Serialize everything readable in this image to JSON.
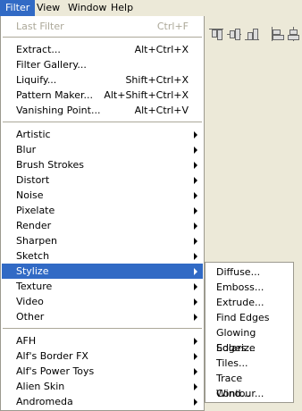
{
  "menubar": {
    "items": [
      {
        "label": "Filter",
        "active": true
      },
      {
        "label": "View",
        "active": false
      },
      {
        "label": "Window",
        "active": false
      },
      {
        "label": "Help",
        "active": false
      }
    ]
  },
  "filter_menu": {
    "last_filter": {
      "label": "Last Filter",
      "shortcut": "Ctrl+F"
    },
    "group1": [
      {
        "label": "Extract...",
        "shortcut": "Alt+Ctrl+X"
      },
      {
        "label": "Filter Gallery...",
        "shortcut": ""
      },
      {
        "label": "Liquify...",
        "shortcut": "Shift+Ctrl+X"
      },
      {
        "label": "Pattern Maker...",
        "shortcut": "Alt+Shift+Ctrl+X"
      },
      {
        "label": "Vanishing Point...",
        "shortcut": "Alt+Ctrl+V"
      }
    ],
    "group2": [
      "Artistic",
      "Blur",
      "Brush Strokes",
      "Distort",
      "Noise",
      "Pixelate",
      "Render",
      "Sharpen",
      "Sketch",
      "Stylize",
      "Texture",
      "Video",
      "Other"
    ],
    "group3": [
      "AFH",
      "Alf's Border FX",
      "Alf's Power Toys",
      "Alien Skin",
      "Andromeda"
    ]
  },
  "stylize_submenu": {
    "items": [
      "Diffuse...",
      "Emboss...",
      "Extrude...",
      "Find Edges",
      "Glowing Edges...",
      "Solarize",
      "Tiles...",
      "Trace Contour...",
      "Wind..."
    ]
  },
  "colors": {
    "highlight": "#316ac5",
    "menu_bg": "#ffffff",
    "chrome": "#ece9d8",
    "disabled_text": "#aca899"
  }
}
